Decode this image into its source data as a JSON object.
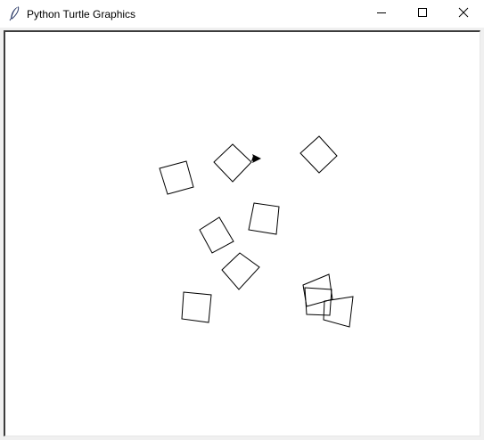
{
  "window": {
    "title": "Python Turtle Graphics",
    "icon": "feather-icon"
  },
  "controls": {
    "minimize_icon": "minimize-icon",
    "maximize_icon": "maximize-icon",
    "close_icon": "close-icon"
  },
  "canvas": {
    "background": "#ffffff",
    "stroke": "#000000",
    "shape_count": 11,
    "turtle_icon": "turtle-cursor-icon"
  }
}
